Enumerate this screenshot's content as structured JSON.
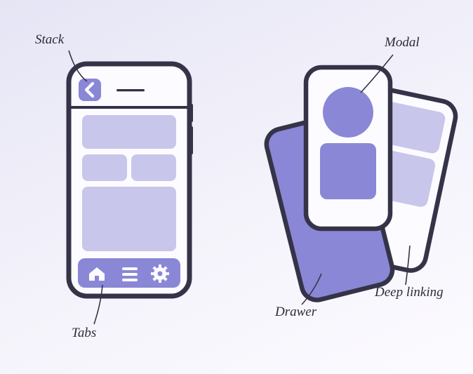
{
  "labels": {
    "stack": "Stack",
    "modal": "Modal",
    "tabs": "Tabs",
    "drawer": "Drawer",
    "deep_linking": "Deep linking"
  },
  "colors": {
    "outline": "#353347",
    "purple_fill": "#8a87d6",
    "purple_light": "#c8c6ea",
    "screen_bg": "#fcfbff",
    "tab_bar": "#8a87d6"
  },
  "icons": {
    "back": "chevron-left",
    "home": "home",
    "menu": "hamburger",
    "settings": "gear"
  }
}
